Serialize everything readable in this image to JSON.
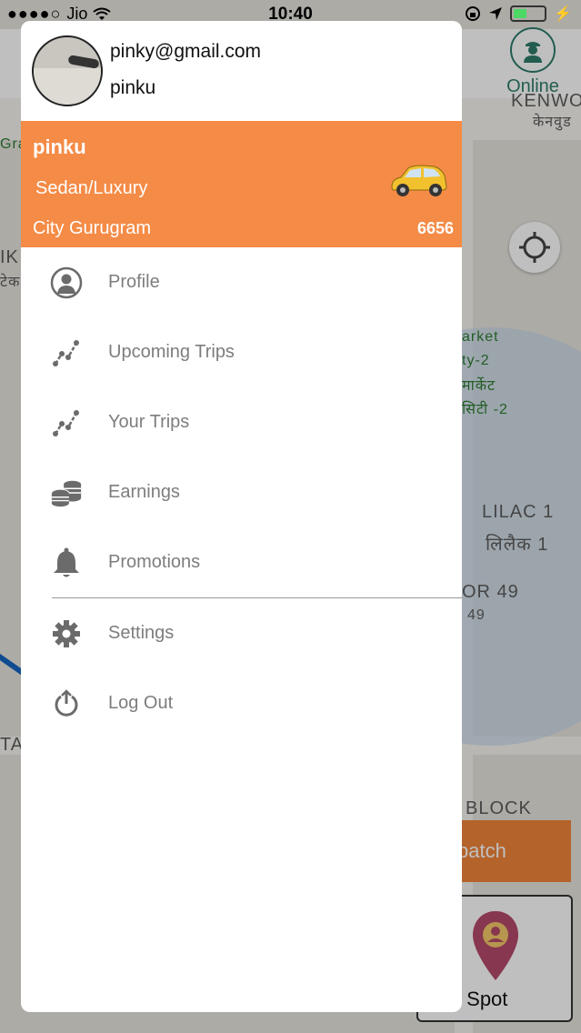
{
  "status_bar": {
    "carrier": "Jio",
    "time": "10:40"
  },
  "map": {
    "online_label": "Online",
    "labels": [
      "KENWO",
      "केनवुड",
      "Gra",
      "IK",
      "टेक",
      "arket",
      "ty-2",
      "मार्केट",
      "सिटी -2",
      "LILAC 1",
      "लिलैक 1",
      "OR 49",
      "49",
      "TA",
      "BLOCK"
    ],
    "dispatch_button": "al Dispatch",
    "demand_spot_label": "mand Spot"
  },
  "drawer": {
    "email": "pinky@gmail.com",
    "username": "pinku",
    "driver": {
      "name": "pinku",
      "vehicle_type": "Sedan/Luxury",
      "city": "City Gurugram",
      "vehicle_number": "6656"
    },
    "menu": [
      {
        "label": "Profile",
        "icon": "profile-icon"
      },
      {
        "label": "Upcoming Trips",
        "icon": "route-icon"
      },
      {
        "label": "Your Trips",
        "icon": "route-icon"
      },
      {
        "label": "Earnings",
        "icon": "coins-icon"
      },
      {
        "label": "Promotions",
        "icon": "bell-icon"
      },
      {
        "label": "Settings",
        "icon": "gear-icon"
      },
      {
        "label": "Log Out",
        "icon": "power-icon"
      }
    ]
  },
  "colors": {
    "accent": "#f48b46",
    "online": "#2e7d6b",
    "menu_text": "#7d7d7d"
  }
}
